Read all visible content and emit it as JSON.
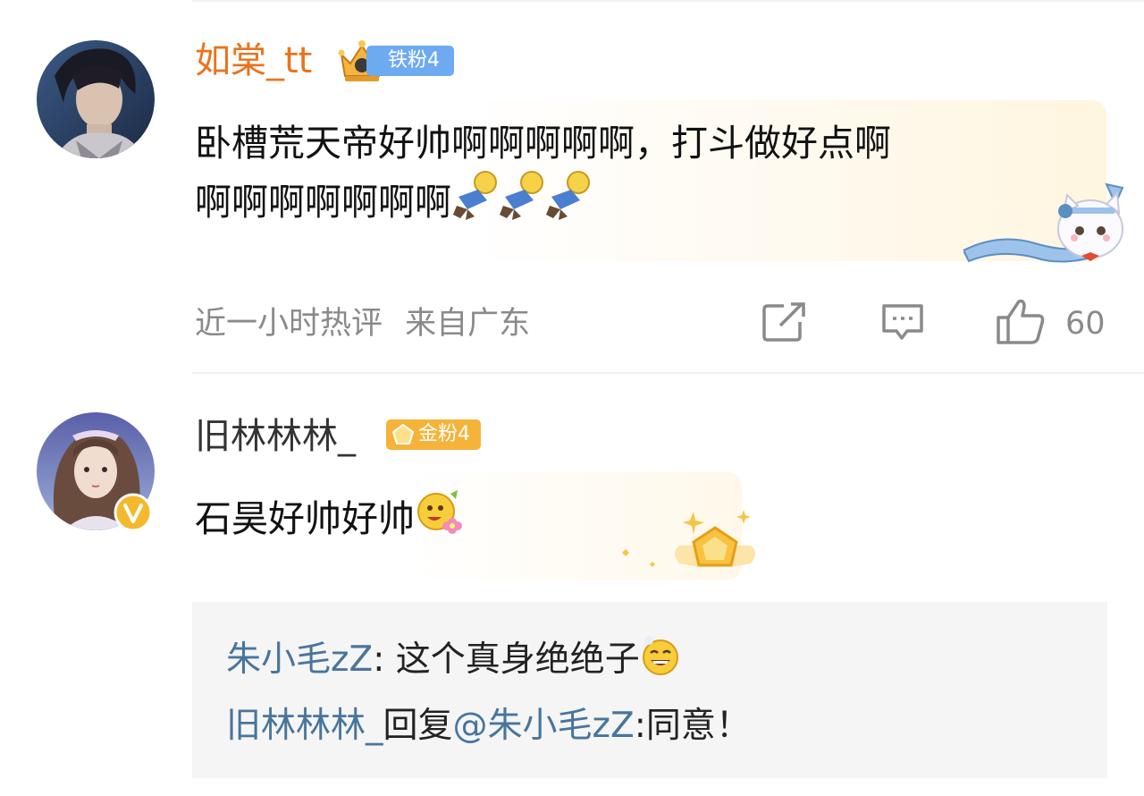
{
  "comments": [
    {
      "username": "如棠_tt",
      "badge": "铁粉4",
      "text_line1": "卧槽荒天帝好帅啊啊啊啊啊，打斗做好点啊",
      "text_line2": "啊啊啊啊啊啊啊",
      "time": "近一小时热评",
      "location": "来自广东",
      "likes": "60"
    },
    {
      "username": "旧林林林_",
      "badge": "金粉4",
      "text": "石昊好帅好帅",
      "replies": [
        {
          "author": "朱小毛zZ",
          "colon": ":",
          "text": " 这个真身绝绝子"
        },
        {
          "author": "旧林林林_",
          "reply_word": "回复",
          "mention": "@朱小毛zZ",
          "text": ":同意！"
        }
      ]
    }
  ],
  "icons": {
    "share": "share-icon",
    "comment": "comment-icon",
    "like": "thumbs-up-icon",
    "verified": "verified-v-icon"
  },
  "colors": {
    "username_orange": "#e8741e",
    "username_gray": "#333333",
    "badge_blue": "#6eaaf0",
    "badge_gold": "#f5b33a",
    "reply_blue": "#48759c"
  }
}
